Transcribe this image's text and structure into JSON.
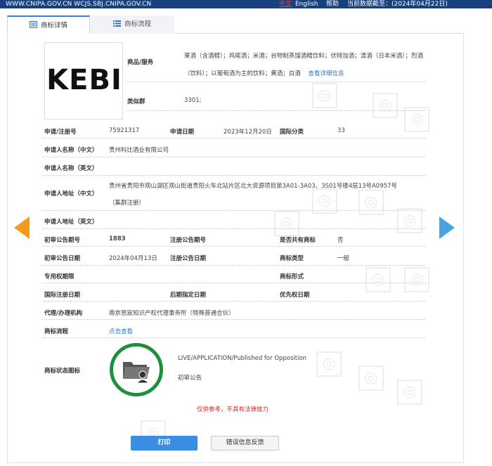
{
  "topbar": {
    "site": "WWW.CNIPA.GOV.CN WCJS.SBJ.CNIPA.GOV.CN",
    "lang_zh": "中文",
    "lang_en": "English",
    "help": "帮助",
    "deadline": "当前数据截至：(2024年04月22日)"
  },
  "tabs": [
    {
      "label": "商标详情",
      "icon": "document-icon"
    },
    {
      "label": "商标流程",
      "icon": "list-icon"
    }
  ],
  "logo": {
    "text": "KEBI"
  },
  "goods": {
    "label": "商品/服务",
    "text": "果酒（含酒精）；鸡尾酒；米酒；谷物制蒸馏酒精饮料；伏特加酒；清酒（日本米酒）；烈酒（饮料）；以葡萄酒为主的饮料；黄酒；白酒",
    "more_link": "查看详细信息"
  },
  "group": {
    "label": "类似群",
    "value": "3301;"
  },
  "fields": {
    "reg_no_label": "申请/注册号",
    "reg_no": "75921317",
    "app_date_label": "申请日期",
    "app_date": "2023年12月20日",
    "intl_class_label": "国际分类",
    "intl_class": "33",
    "applicant_cn_label": "申请人名称（中文）",
    "applicant_cn": "贵州科比酒业有限公司",
    "applicant_en_label": "申请人名称（英文）",
    "applicant_en": "",
    "address_cn_label": "申请人地址（中文）",
    "address_cn_line1": "贵州省贵阳市观山湖区观山街道贵阳火车北站片区北大资源项目第3A01-3A03、3S01号楼4层13号A0957号",
    "address_cn_line2": "（集群注册）",
    "address_en_label": "申请人地址（英文）",
    "address_en": "",
    "prelim_no_label": "初审公告期号",
    "prelim_no": "1883",
    "reg_pub_no_label": "注册公告期号",
    "reg_pub_no": "",
    "shared_label": "是否共有商标",
    "shared": "否",
    "prelim_date_label": "初审公告日期",
    "prelim_date": "2024年04月13日",
    "reg_pub_date_label": "注册公告日期",
    "reg_pub_date": "",
    "tm_type_label": "商标类型",
    "tm_type": "一般",
    "exclusive_label": "专用权期限",
    "exclusive": "",
    "tm_form_label": "商标形式",
    "tm_form": "",
    "intl_reg_date_label": "国际注册日期",
    "later_date_label": "后期指定日期",
    "priority_date_label": "优先权日期",
    "agent_label": "代理/办理机构",
    "agent": "南京思宸知识产权代理事务所（特殊普通合伙）",
    "process_label": "商标流程",
    "process_link": "点击查看",
    "status_label": "商标状态图标",
    "status_en": "LIVE/APPLICATION/Published for Opposition",
    "status_cn": "初审公告"
  },
  "disclaimer": "仅供参考，不具有法律效力",
  "buttons": {
    "print": "打印",
    "feedback": "错误信息反馈"
  },
  "colors": {
    "topbar": "#16407e",
    "status_ring": "#1e8f3a",
    "prev_arrow": "#f29b1d",
    "next_arrow": "#4aa3df",
    "print_button": "#3b8de2",
    "disclaimer": "#d9281c"
  }
}
